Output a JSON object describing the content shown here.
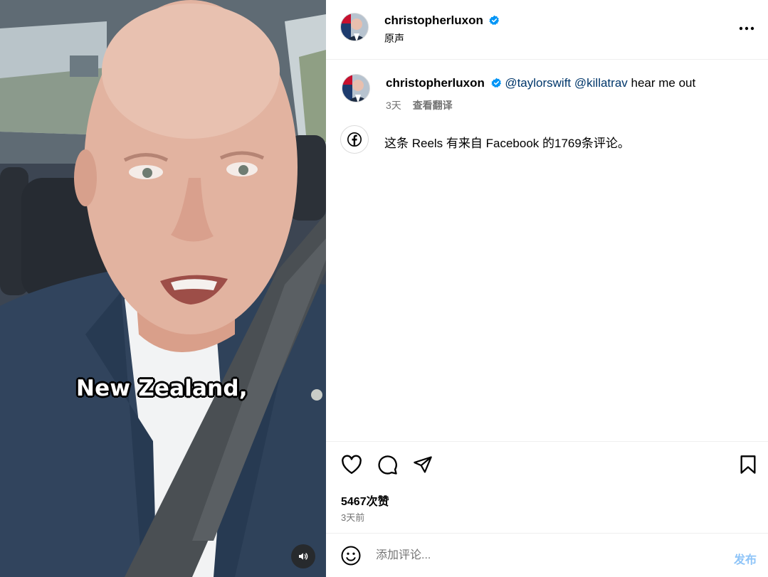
{
  "video": {
    "caption": "New Zealand,"
  },
  "post": {
    "username": "christopherluxon",
    "audio_label": "原声"
  },
  "comment": {
    "username": "christopherluxon",
    "mention_1": "@taylorswift",
    "mention_2": "@killatrav",
    "text": "hear me out",
    "age": "3天",
    "translate_label": "查看翻译"
  },
  "facebook_note": {
    "text": "这条 Reels 有来自 Facebook 的1769条评论。"
  },
  "engagement": {
    "likes": "5467次赞",
    "posted_ago": "3天前"
  },
  "composer": {
    "placeholder": "添加评论...",
    "post_label": "发布"
  },
  "colors": {
    "verified": "#0095f6",
    "mention": "#00376b",
    "post_button": "#8ec4f8",
    "muted_text": "#737373"
  },
  "icons": {
    "verified": "verified-badge-icon",
    "more": "more-options-icon",
    "facebook": "facebook-icon",
    "like": "heart-icon",
    "comment": "comment-bubble-icon",
    "share": "paper-plane-icon",
    "save": "bookmark-icon",
    "emoji": "emoji-smile-icon",
    "audio": "speaker-icon"
  }
}
